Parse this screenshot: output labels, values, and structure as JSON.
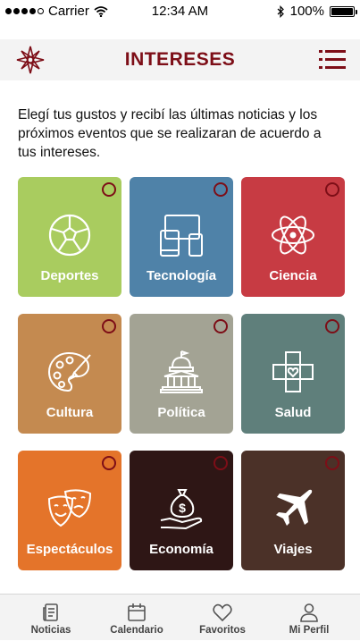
{
  "status_bar": {
    "carrier": "Carrier",
    "time": "12:34 AM",
    "battery": "100%"
  },
  "header": {
    "title": "INTERESES",
    "logo_icon": "star-logo-icon",
    "menu_icon": "list-menu-icon"
  },
  "intro_text": "Elegí tus gustos y recibí las últimas noticias y los próximos eventos que se realizaran de acuerdo a tus intereses.",
  "accent_color": "#7d0e17",
  "categories": [
    {
      "label": "Deportes",
      "icon": "soccer-ball-icon",
      "color": "#a9cc5f",
      "selected": false
    },
    {
      "label": "Tecnología",
      "icon": "devices-icon",
      "color": "#4f82a8",
      "selected": false
    },
    {
      "label": "Ciencia",
      "icon": "atom-icon",
      "color": "#c73b43",
      "selected": false
    },
    {
      "label": "Cultura",
      "icon": "palette-icon",
      "color": "#c48a50",
      "selected": false
    },
    {
      "label": "Política",
      "icon": "capitol-icon",
      "color": "#a3a394",
      "selected": false
    },
    {
      "label": "Salud",
      "icon": "health-cross-icon",
      "color": "#5f7f7b",
      "selected": false
    },
    {
      "label": "Espectáculos",
      "icon": "theater-masks-icon",
      "color": "#e4742a",
      "selected": false
    },
    {
      "label": "Economía",
      "icon": "money-bag-hand-icon",
      "color": "#2e1615",
      "selected": false
    },
    {
      "label": "Viajes",
      "icon": "airplane-icon",
      "color": "#4b3128",
      "selected": false
    }
  ],
  "tabs": [
    {
      "label": "Noticias",
      "icon": "news-icon"
    },
    {
      "label": "Calendario",
      "icon": "calendar-icon"
    },
    {
      "label": "Favoritos",
      "icon": "heart-icon"
    },
    {
      "label": "Mi Perfil",
      "icon": "user-icon"
    }
  ]
}
